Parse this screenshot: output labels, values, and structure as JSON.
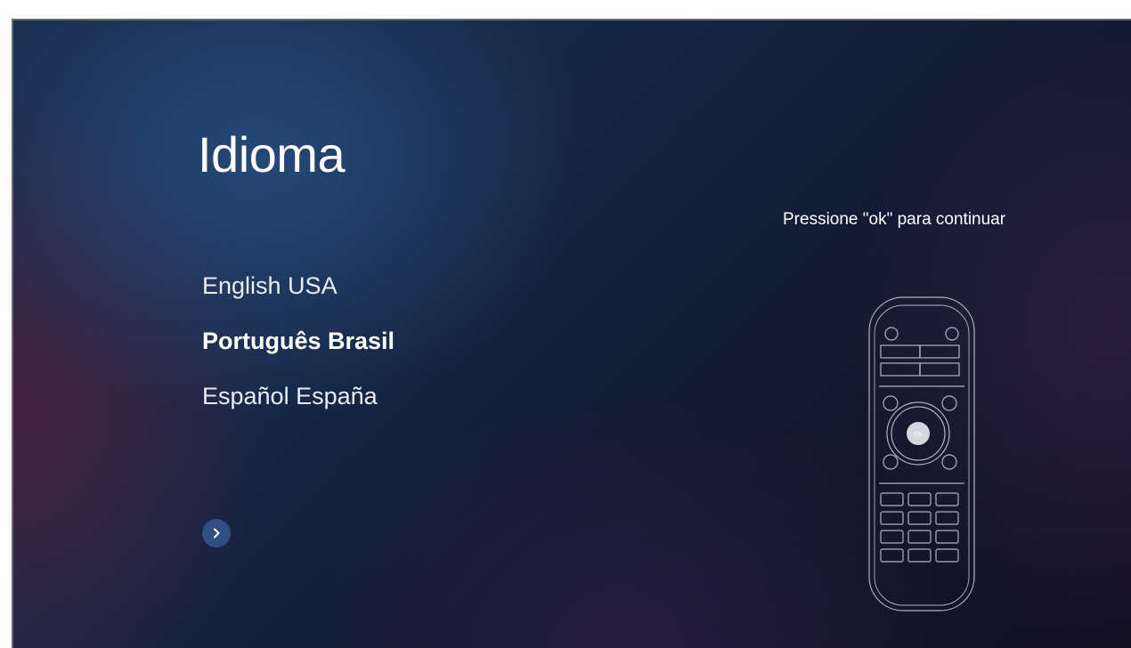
{
  "page": {
    "title": "Idioma",
    "hint": "Pressione \"ok\" para continuar"
  },
  "languages": [
    {
      "label": "English USA",
      "selected": false
    },
    {
      "label": "Português Brasil",
      "selected": true
    },
    {
      "label": "Español España",
      "selected": false
    }
  ],
  "next_button": {
    "icon": "chevron-right-icon"
  },
  "remote": {
    "icon": "remote-control-icon",
    "ok_label": "OK"
  },
  "colors": {
    "text": "#ffffff",
    "next_button_bg": "#2f4e82",
    "remote_outline": "#c8cfdc"
  }
}
